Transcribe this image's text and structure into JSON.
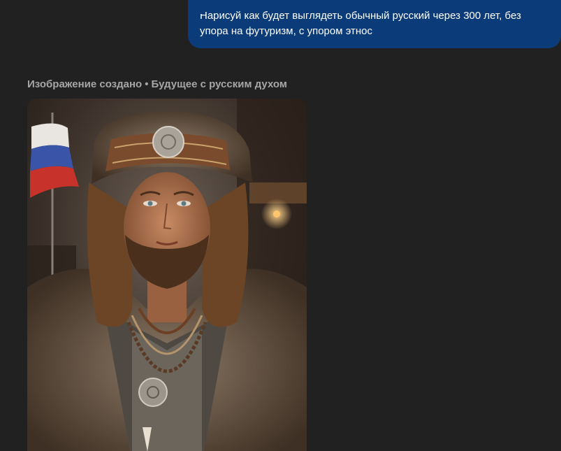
{
  "user_message": {
    "text": "Нарисуй как будет выглядеть обычный русский через 300 лет, без упора на футуризм, с упором этнос"
  },
  "assistant": {
    "status": "Изображение создано",
    "separator": "•",
    "title": "Будущее с русским духом"
  },
  "image": {
    "subject": "man-in-fur-hat-portrait-icon",
    "colors": {
      "user_bubble": "#0b3c79",
      "background": "#212121",
      "flag_white": "#e9e6e2",
      "flag_blue": "#3a55a8",
      "flag_red": "#c7322a"
    }
  }
}
